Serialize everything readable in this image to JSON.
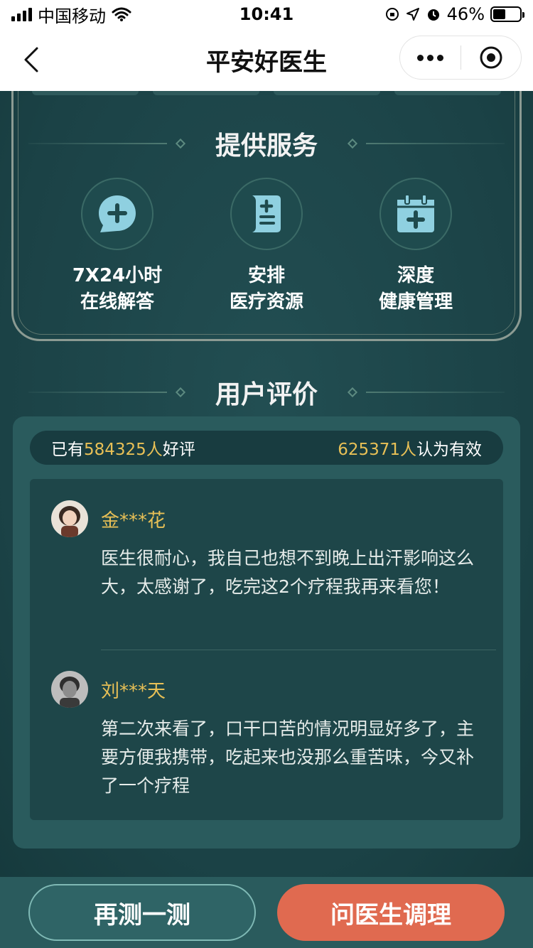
{
  "status_bar": {
    "carrier": "中国移动",
    "time": "10:41",
    "battery": "46%",
    "battery_level": 0.46
  },
  "nav": {
    "title": "平安好医生"
  },
  "services": {
    "title": "提供服务",
    "items": [
      {
        "icon": "chat-plus-icon",
        "line1": "7X24小时",
        "line2": "在线解答"
      },
      {
        "icon": "document-plus-icon",
        "line1": "安排",
        "line2": "医疗资源"
      },
      {
        "icon": "calendar-plus-icon",
        "line1": "深度",
        "line2": "健康管理"
      }
    ]
  },
  "reviews": {
    "title": "用户评价",
    "stats": {
      "left_prefix": "已有",
      "left_number": "584325人",
      "left_suffix": "好评",
      "right_number": "625371人",
      "right_suffix": "认为有效"
    },
    "items": [
      {
        "name": "金***花",
        "text": "医生很耐心，我自己也想不到晚上出汗影响这么大，太感谢了，吃完这2个疗程我再来看您！"
      },
      {
        "name": "刘***天",
        "text": "第二次来看了，口干口苦的情况明显好多了，主要方便我携带，吃起来也没那么重苦味，今又补了一个疗程"
      }
    ]
  },
  "buttons": {
    "retest": "再测一测",
    "ask_doctor": "问医生调理"
  },
  "colors": {
    "background": "#1d4549",
    "accent_gold": "#e8c056",
    "ask_button": "#e06a50",
    "icon_blue": "#8fd0e0"
  }
}
